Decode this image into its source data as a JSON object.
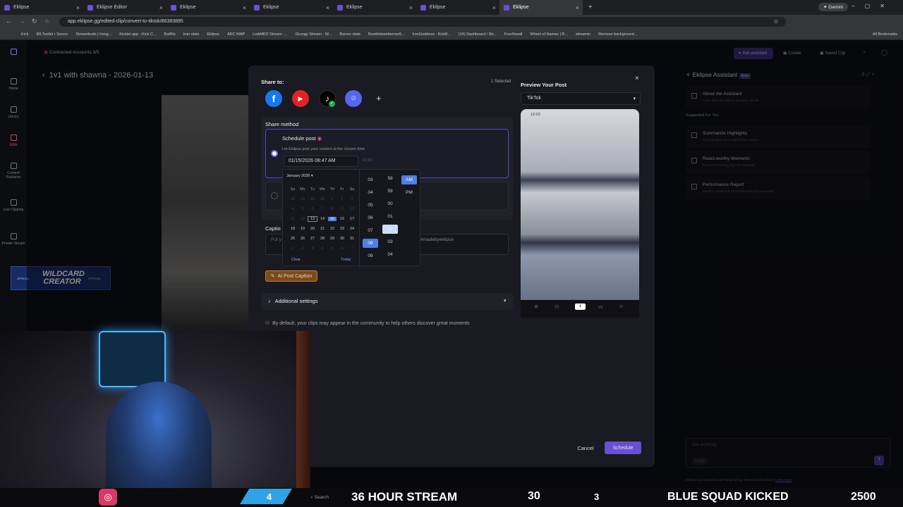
{
  "browser": {
    "tabs": [
      "Eklipse",
      "Eklipse Editor",
      "Eklipse",
      "Eklipse",
      "Eklipse",
      "Eklipse",
      "Eklipse"
    ],
    "gemini": "Gemini",
    "url": "app.eklipse.gg/edited-clip/convert-to-tiktok/86383895",
    "bookmarks": [
      "Kick",
      "IRLToolkit • Server",
      "Streamloots | Irong...",
      "Kicklet.app - Kick C...",
      "BotRix",
      "Iron stats",
      "Eklipse",
      "ARC MAP",
      "LinkMKD Stream -...",
      "Grungy Stream - W...",
      "Barren stats",
      "Bumblebeefarmer8...",
      "IronGoddess - Kick8...",
      "(14) Dashboard / Str...",
      "Fourthwall",
      "Wheel of Names | R...",
      "streamin",
      "Remove background...",
      "All Bookmarks"
    ]
  },
  "app": {
    "connected": "Connected Accounts 3/5",
    "clip_title": "1v1 with shawna - 2026-01-13",
    "sidebar": [
      "Home",
      "Library",
      "Edits",
      "Content Publisher",
      "Live Clipping",
      "Private Stream"
    ],
    "top_actions": [
      "Ask assistant",
      "Create",
      "Saved Clip"
    ],
    "sidebar_logo": "WILDCARD CREATOR",
    "sidebar_logo_tag": "OFFICIAL"
  },
  "modal": {
    "share_to": "Share to:",
    "selected": "1 Selected",
    "share_method": "Share method",
    "schedule_post": "Schedule post",
    "schedule_desc": "Let Eklipse post your content at the chosen time",
    "datetime_value": "01/15/2026 08:47 AM",
    "time_hint": "01:30",
    "caption_label": "Captio",
    "caption_placeholder": "Put y",
    "hashtag": "#madebyeklipse",
    "ai_caption": "AI Post Caption",
    "additional_settings": "Additional settings",
    "community_note": "By default, your clips may appear in the community to help others discover great moments",
    "cancel": "Cancel",
    "schedule": "Schedule",
    "preview_title": "Preview Your Post",
    "platform": "TikTok",
    "phone_time": "12:22"
  },
  "calendar": {
    "month": "January 2026",
    "weekdays": [
      "Su",
      "Mo",
      "Tu",
      "We",
      "Th",
      "Fr",
      "Sa"
    ],
    "rows": [
      [
        "28",
        "29",
        "30",
        "31",
        "1",
        "2",
        "3"
      ],
      [
        "4",
        "5",
        "6",
        "7",
        "8",
        "9",
        "10"
      ],
      [
        "11",
        "12",
        "13",
        "14",
        "15",
        "16",
        "17"
      ],
      [
        "18",
        "19",
        "20",
        "21",
        "22",
        "23",
        "24"
      ],
      [
        "25",
        "26",
        "27",
        "28",
        "29",
        "30",
        "31"
      ],
      [
        "1",
        "2",
        "3",
        "4",
        "5",
        "6",
        "7"
      ]
    ],
    "clear": "Clear",
    "today": "Today",
    "hours": [
      "03",
      "04",
      "05",
      "06",
      "07",
      "08",
      "09"
    ],
    "minutes": [
      "58",
      "59",
      "00",
      "01",
      "02",
      "03",
      "04"
    ],
    "ampm": [
      "AM",
      "PM"
    ]
  },
  "assistant": {
    "title": "Eklipse Assistant",
    "beta": "Beta",
    "about": "About the Assistant",
    "about_desc": "Learn what the Eklipse assistant can do",
    "suggested": "Suggested For You",
    "items": [
      {
        "title": "Summarize Highlights",
        "desc": "Key highlights and insights from session."
      },
      {
        "title": "React-worthy Moments",
        "desc": "Funny or shocking clips for reactions."
      },
      {
        "title": "Performance Report",
        "desc": "Session review with successes and improvements."
      }
    ],
    "input_placeholder": "Ask anything",
    "credit": "0.00$",
    "disclaimer": "Eklipse can sometimes get things wrong. Please double-check.",
    "learn_more": "Learn more"
  },
  "overlay": {
    "count_left": "4",
    "stream_text": "36 HOUR STREAM",
    "count_mid": "30",
    "count_right": "3",
    "kicked": "BLUE SQUAD KICKED",
    "total": "2500",
    "search": "Search"
  }
}
